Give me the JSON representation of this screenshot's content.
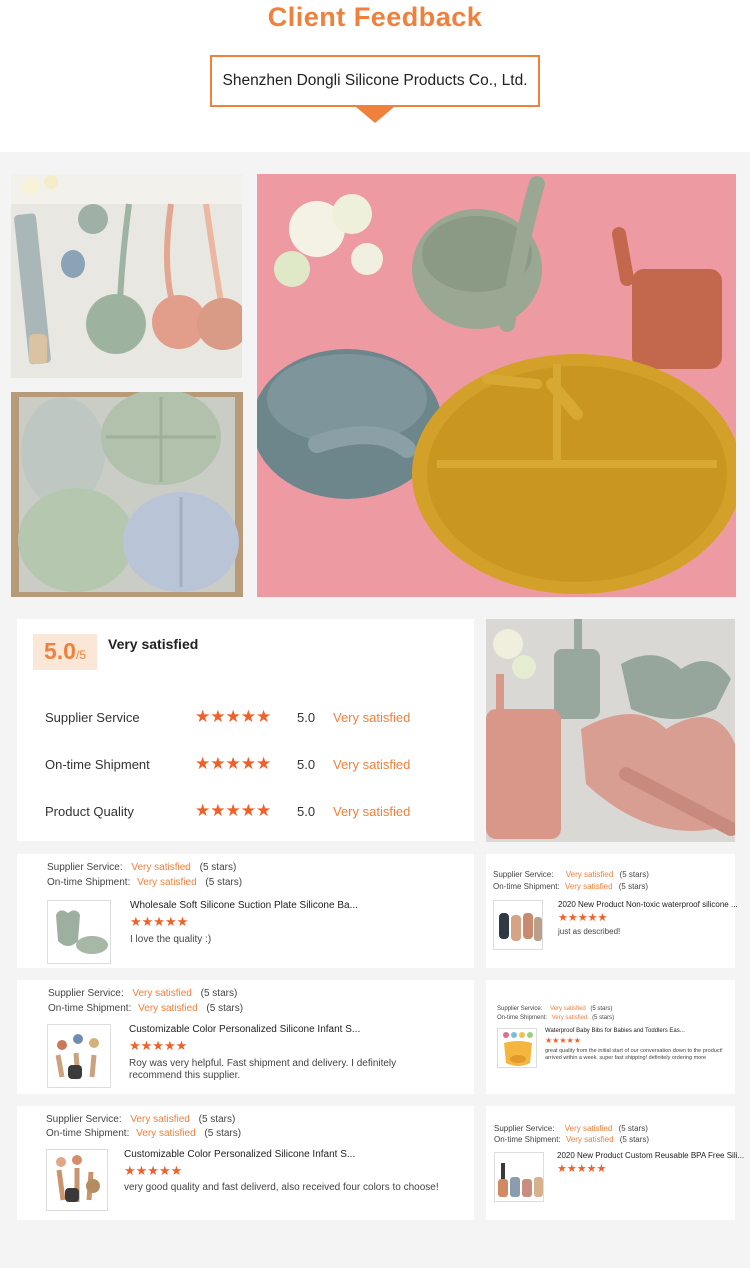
{
  "header": {
    "title": "Client Feedback",
    "company": "Shenzhen Dongli Silicone Products Co., Ltd."
  },
  "rating": {
    "score": "5.0",
    "out_of": "/5",
    "overall_label": "Very satisfied",
    "metrics": [
      {
        "name": "Supplier Service",
        "stars": "★★★★★",
        "score": "5.0",
        "label": "Very satisfied"
      },
      {
        "name": "On-time Shipment",
        "stars": "★★★★★",
        "score": "5.0",
        "label": "Very satisfied"
      },
      {
        "name": "Product Quality",
        "stars": "★★★★★",
        "score": "5.0",
        "label": "Very satisfied"
      }
    ]
  },
  "reviews": [
    {
      "supplier_label": "Supplier Service:",
      "supplier_value": "Very satisfied",
      "supplier_stars": "(5 stars)",
      "shipment_label": "On-time Shipment:",
      "shipment_value": "Very satisfied",
      "shipment_stars": "(5 stars)",
      "product": "Wholesale Soft Silicone Suction Plate Silicone Ba...",
      "stars": "★★★★★",
      "comment": "I love the quality :)"
    },
    {
      "supplier_label": "Supplier Service:",
      "supplier_value": "Very satisfied",
      "supplier_stars": "(5 stars)",
      "shipment_label": "On-time Shipment:",
      "shipment_value": "Very satisfied",
      "shipment_stars": "(5 stars)",
      "product": "2020 New Product Non-toxic waterproof silicone ...",
      "stars": "★★★★★",
      "comment": "just as described!"
    },
    {
      "supplier_label": "Supplier Service:",
      "supplier_value": "Very satisfied",
      "supplier_stars": "(5 stars)",
      "shipment_label": "On-time Shipment:",
      "shipment_value": "Very satisfied",
      "shipment_stars": "(5 stars)",
      "product": "Customizable Color Personalized Silicone Infant S...",
      "stars": "★★★★★",
      "comment": "Roy was very helpful. Fast shipment and delivery. I definitely recommend this supplier."
    },
    {
      "supplier_label": "Supplier Service:",
      "supplier_value": "Very satisfied",
      "supplier_stars": "(5 stars)",
      "shipment_label": "On-time Shipment:",
      "shipment_value": "Very satisfied",
      "shipment_stars": "(5 stars)",
      "product": "Waterproof Baby Bibs for Babies and Toddlers Eas...",
      "stars": "★★★★★",
      "comment": "great quality from the initial start of our conversation down to the product! arrived within a week. super fast shipping! definitely ordering more"
    },
    {
      "supplier_label": "Supplier Service:",
      "supplier_value": "Very satisfied",
      "supplier_stars": "(5 stars)",
      "shipment_label": "On-time Shipment:",
      "shipment_value": "Very satisfied",
      "shipment_stars": "(5 stars)",
      "product": "Customizable Color Personalized Silicone Infant S...",
      "stars": "★★★★★",
      "comment": "very good quality and fast deliverd, also received four colors to choose!"
    },
    {
      "supplier_label": "Supplier Service:",
      "supplier_value": "Very satisfied",
      "supplier_stars": "(5 stars)",
      "shipment_label": "On-time Shipment:",
      "shipment_value": "Very satisfied",
      "shipment_stars": "(5 stars)",
      "product": "2020 New Product Custom Reusable BPA Free Sili...",
      "stars": "★★★★★",
      "comment": ""
    }
  ],
  "colors": {
    "accent": "#f0813c",
    "star": "#f0602a",
    "background": "#f4f4f4"
  }
}
